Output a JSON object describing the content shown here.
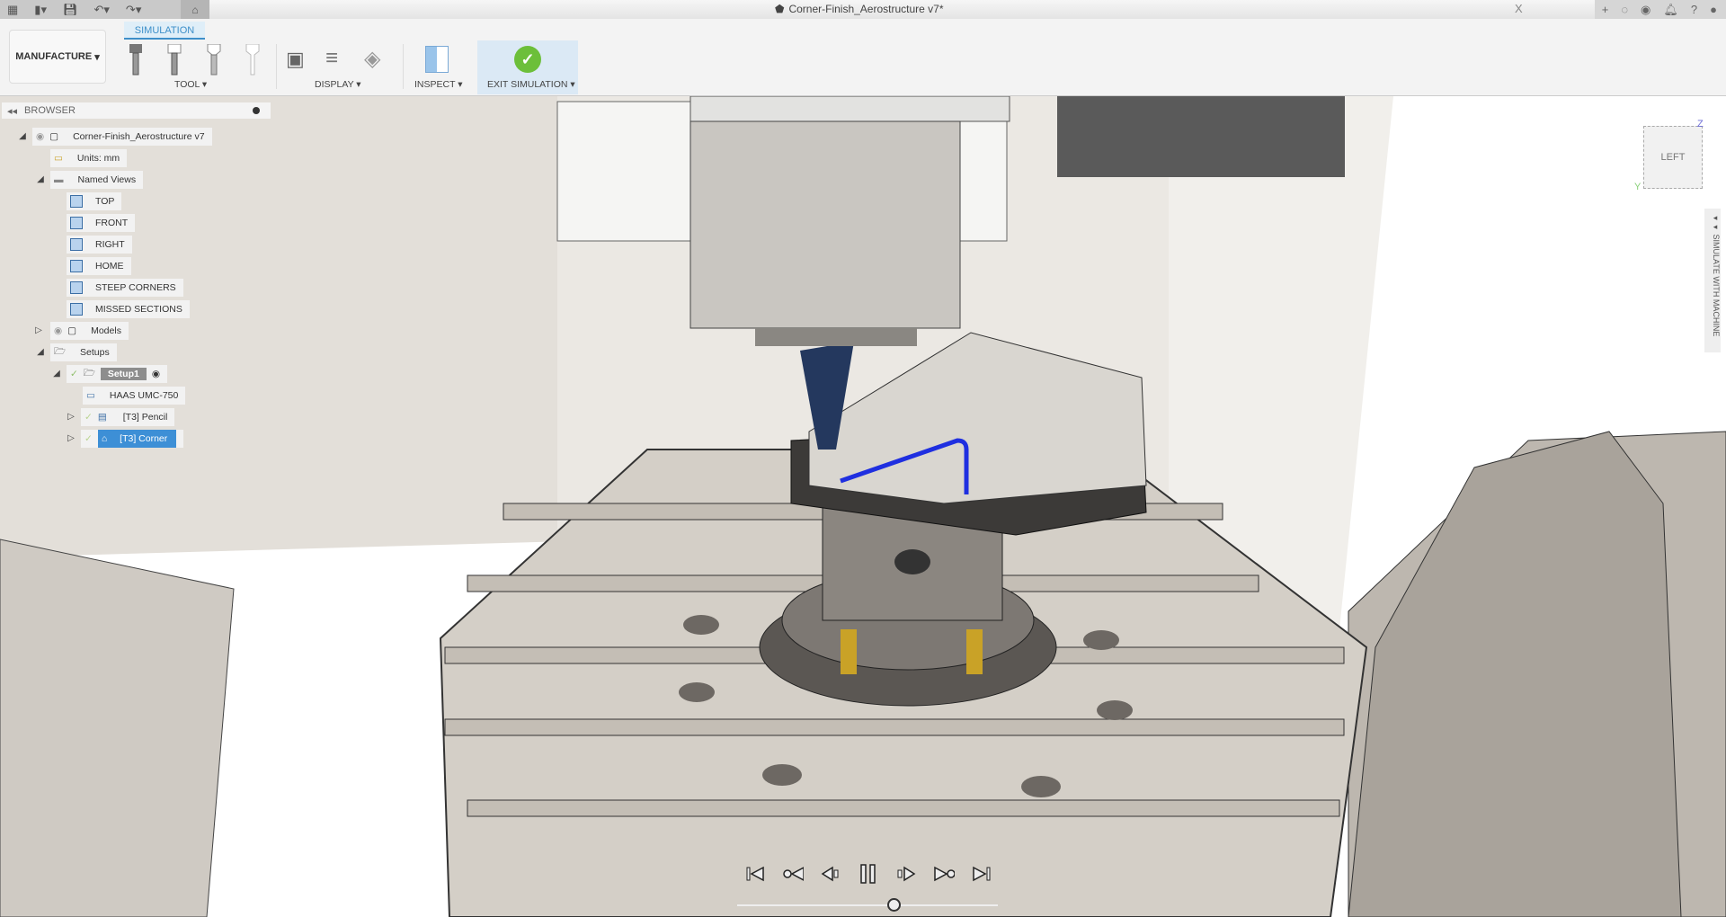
{
  "titlebar": {
    "document_title": "Corner-Finish_Aerostructure v7*",
    "close": "X"
  },
  "ribbon": {
    "active_tab": "SIMULATION",
    "workspace": "MANUFACTURE",
    "groups": [
      {
        "label": "TOOL"
      },
      {
        "label": "DISPLAY"
      },
      {
        "label": "INSPECT"
      },
      {
        "label": "EXIT SIMULATION"
      }
    ]
  },
  "browser": {
    "title": "BROWSER",
    "root": "Corner-Finish_Aerostructure v7",
    "units": "Units: mm",
    "named_views_label": "Named Views",
    "named_views": [
      "TOP",
      "FRONT",
      "RIGHT",
      "HOME",
      "STEEP CORNERS",
      "MISSED SECTIONS"
    ],
    "models": "Models",
    "setups": "Setups",
    "setup1": "Setup1",
    "machine": "HAAS UMC-750",
    "ops": [
      {
        "label": "[T3] Pencil",
        "selected": false
      },
      {
        "label": "[T3] Corner",
        "selected": true
      }
    ]
  },
  "viewcube": {
    "face": "LEFT",
    "axis_z": "Z",
    "axis_y": "Y"
  },
  "side_panel": {
    "label": "SIMULATE WITH MACHINE"
  },
  "playback": {
    "position_fraction": 0.6
  },
  "colors": {
    "accent": "#3d8fd6",
    "exit_green": "#6cbf3a",
    "toolpath": "#1f2fe0"
  }
}
